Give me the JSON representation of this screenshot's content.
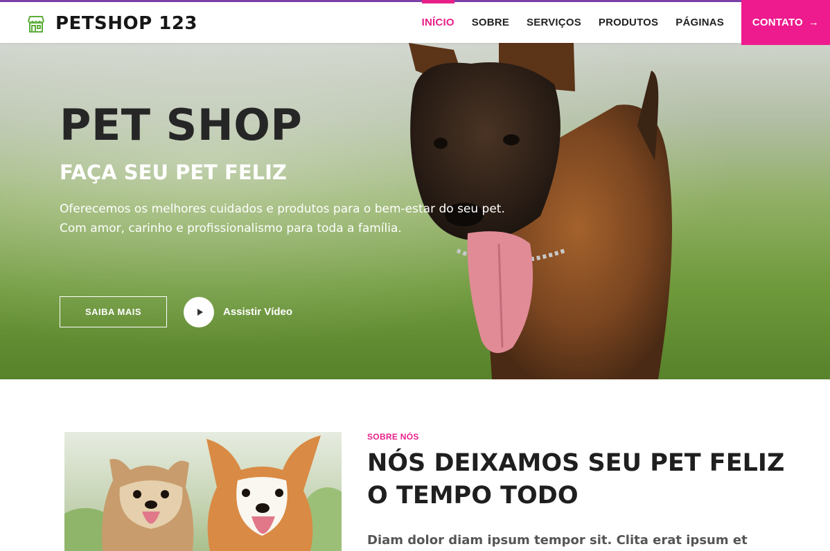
{
  "brand": {
    "name": "PETSHOP 123",
    "icon": "storefront-icon",
    "icon_color": "#5dae3a"
  },
  "nav": {
    "items": [
      {
        "label": "INÍCIO",
        "active": true
      },
      {
        "label": "SOBRE",
        "active": false
      },
      {
        "label": "SERVIÇOS",
        "active": false
      },
      {
        "label": "PRODUTOS",
        "active": false
      },
      {
        "label": "PÁGINAS",
        "active": false
      }
    ],
    "cta": {
      "label": "CONTATO",
      "icon": "arrow-right-icon"
    }
  },
  "hero": {
    "title": "PET SHOP",
    "subtitle": "FAÇA SEU PET FELIZ",
    "text_line1": "Oferecemos os melhores cuidados e produtos para o bem-estar do seu pet.",
    "text_line2": "Com amor, carinho e profissionalismo para toda a família.",
    "button_label": "SAIBA MAIS",
    "video_label": "Assistir Vídeo",
    "video_icon": "play-icon"
  },
  "about": {
    "kicker": "SOBRE NÓS",
    "title": "NÓS DEIXAMOS SEU PET FELIZ O TEMPO TODO",
    "lead": "Diam dolor diam ipsum tempor sit. Clita erat ipsum et"
  },
  "colors": {
    "accent": "#ee1b8e",
    "top_border": "#7b3fa8",
    "dark_text": "#222222"
  }
}
